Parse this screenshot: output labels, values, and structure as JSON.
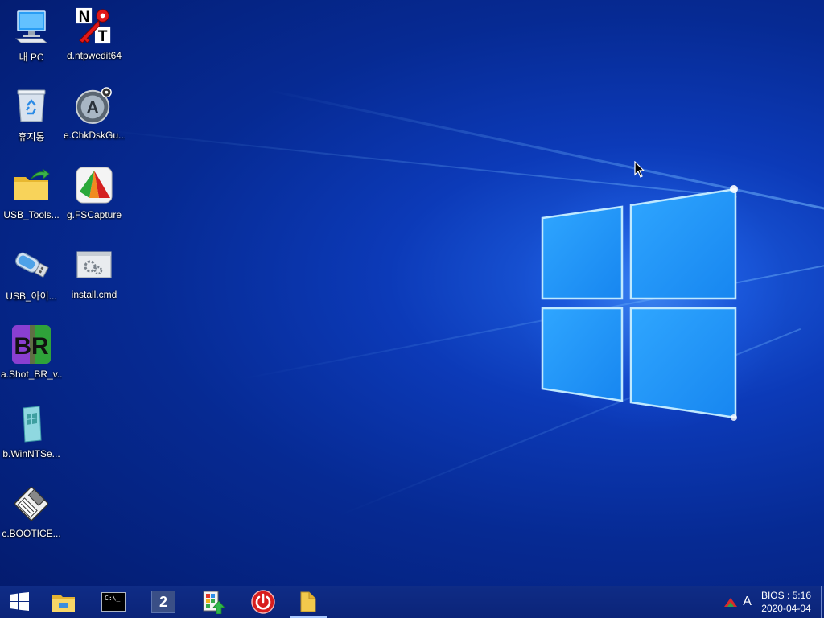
{
  "desktop": {
    "icons": [
      {
        "label": "내 PC",
        "icon": "computer-icon"
      },
      {
        "label": "휴지통",
        "icon": "recycle-bin-icon"
      },
      {
        "label": "USB_Tools...",
        "icon": "folder-icon"
      },
      {
        "label": "USB_아이...",
        "icon": "usb-drive-icon"
      },
      {
        "label": "a.Shot_BR_v...",
        "icon": "br-app-icon"
      },
      {
        "label": "b.WinNTSe...",
        "icon": "winntsetup-icon"
      },
      {
        "label": "c.BOOTICE...",
        "icon": "bootice-icon"
      },
      {
        "label": "d.ntpwedit64",
        "icon": "ntpwedit-icon"
      },
      {
        "label": "e.ChkDskGu...",
        "icon": "chkdsk-icon"
      },
      {
        "label": "g.FSCapture",
        "icon": "fscapture-icon"
      },
      {
        "label": "install.cmd",
        "icon": "cmd-script-icon"
      }
    ]
  },
  "taskbar": {
    "buttons": [
      {
        "name": "start-button",
        "icon": "windows-logo-icon"
      },
      {
        "name": "file-explorer-button",
        "icon": "file-explorer-icon"
      },
      {
        "name": "command-prompt-button",
        "icon": "command-prompt-icon",
        "text": "C:\\_"
      },
      {
        "name": "app-2-button",
        "icon": "number-2-icon",
        "text": "2"
      },
      {
        "name": "program-launcher-button",
        "icon": "launcher-icon"
      },
      {
        "name": "power-button",
        "icon": "power-icon"
      },
      {
        "name": "folder-button",
        "icon": "folder-icon",
        "active": true
      }
    ],
    "tray": {
      "ime": "A",
      "time": "BIOS : 5:16",
      "date": "2020-04-04"
    }
  },
  "colors": {
    "wallpaper": "#0c3ab8",
    "taskbar": "#0d2880",
    "logo": "#4fc3ff"
  }
}
